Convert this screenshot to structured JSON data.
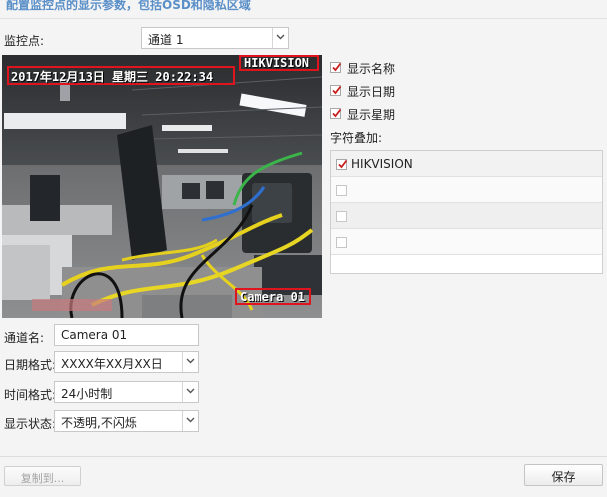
{
  "header": {
    "title": "配置监控点的显示参数，包括OSD和隐私区域"
  },
  "monitor": {
    "label": "监控点:",
    "value": "通道 1"
  },
  "video": {
    "osd_datetime": "2017年12月13日  星期三  20:22:34",
    "osd_logo": "HIKVISION",
    "osd_camera_name": "Camera 01"
  },
  "display_options": [
    {
      "label": "显示名称",
      "checked": true
    },
    {
      "label": "显示日期",
      "checked": true
    },
    {
      "label": "显示星期",
      "checked": true
    }
  ],
  "overlay": {
    "label": "字符叠加:",
    "rows": [
      {
        "text": "HIKVISION",
        "checked": true
      },
      {
        "text": "",
        "checked": false
      },
      {
        "text": "",
        "checked": false
      },
      {
        "text": "",
        "checked": false
      }
    ]
  },
  "form": {
    "channel_name": {
      "label": "通道名:",
      "value": "Camera 01"
    },
    "date_format": {
      "label": "日期格式:",
      "value": "XXXX年XX月XX日"
    },
    "time_format": {
      "label": "时间格式:",
      "value": "24小时制"
    },
    "display_state": {
      "label": "显示状态:",
      "value": "不透明,不闪烁"
    }
  },
  "buttons": {
    "copy": "复制到...",
    "save": "保存"
  },
  "colors": {
    "accent": "#5a8fc8",
    "check": "#c81e1e",
    "osd_red": "#e0141e"
  }
}
